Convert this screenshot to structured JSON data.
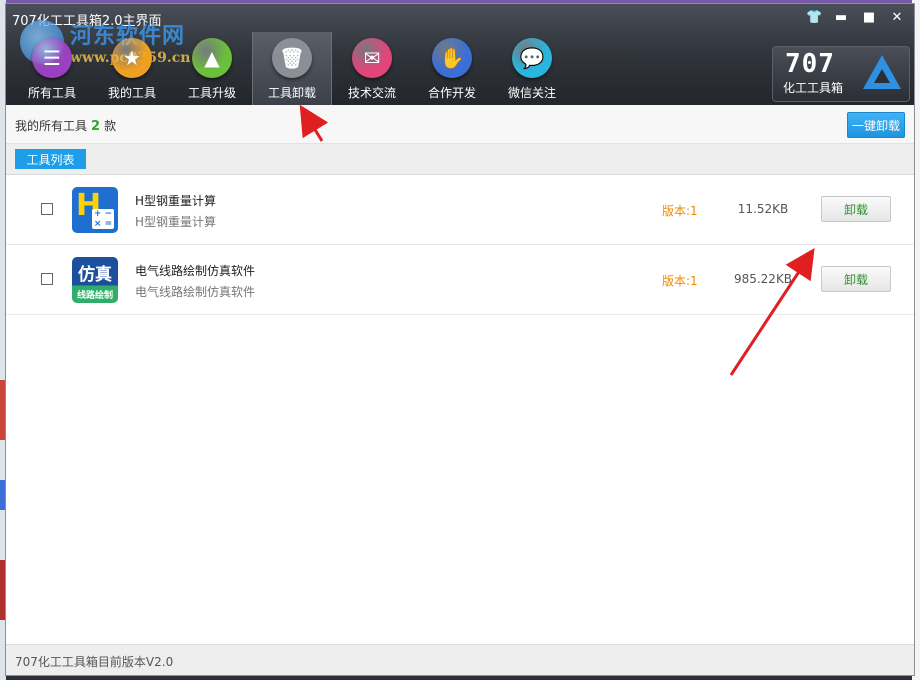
{
  "window": {
    "title": "707化工工具箱2.0主界面",
    "controls": [
      "shirt-icon",
      "minimize-icon",
      "maximize-icon",
      "close-icon"
    ]
  },
  "watermark": {
    "name": "河东软件网",
    "url": "www.pc0359.cn"
  },
  "nav": {
    "items": [
      {
        "label": "所有工具",
        "icon": "all-tools-icon",
        "color": "#9b3fc4",
        "glyph": "☰"
      },
      {
        "label": "我的工具",
        "icon": "my-tools-icon",
        "color": "#f0a020",
        "glyph": "★"
      },
      {
        "label": "工具升级",
        "icon": "upgrade-icon",
        "color": "#6cbf3a",
        "glyph": "▲"
      },
      {
        "label": "工具卸载",
        "icon": "trash-icon",
        "color": "#8a8f98",
        "glyph": "🗑"
      },
      {
        "label": "技术交流",
        "icon": "exchange-icon",
        "color": "#e2457a",
        "glyph": "✉"
      },
      {
        "label": "合作开发",
        "icon": "handshake-icon",
        "color": "#3a6fd8",
        "glyph": "✋"
      },
      {
        "label": "微信关注",
        "icon": "wechat-icon",
        "color": "#28b6e0",
        "glyph": "💬"
      }
    ],
    "active_index": 3
  },
  "brand": {
    "number": "707",
    "subtitle": "化工工具箱"
  },
  "info": {
    "prefix": "我的所有工具",
    "count": "2",
    "suffix": "款",
    "uninstall_all": "一键卸载"
  },
  "tabs": {
    "list_label": "工具列表"
  },
  "tools": [
    {
      "name": "H型钢重量计算",
      "desc": "H型钢重量计算",
      "version": "版本:1",
      "size": "11.52KB",
      "action": "卸载",
      "icon": "h-steel-calculator-icon",
      "icon_color": "#1f6fd0"
    },
    {
      "name": "电气线路绘制仿真软件",
      "desc": "电气线路绘制仿真软件",
      "version": "版本:1",
      "size": "985.22KB",
      "action": "卸载",
      "icon": "circuit-simulation-icon",
      "icon_color": "#1c4f9c",
      "icon_text_top": "仿真",
      "icon_text_bottom": "线路绘制"
    }
  ],
  "status": {
    "text": "707化工工具箱目前版本V2.0"
  },
  "colors": {
    "accent": "#1f9ee8",
    "count_green": "#2ea72e",
    "version_orange": "#f08a00",
    "arrow_red": "#e02020"
  }
}
